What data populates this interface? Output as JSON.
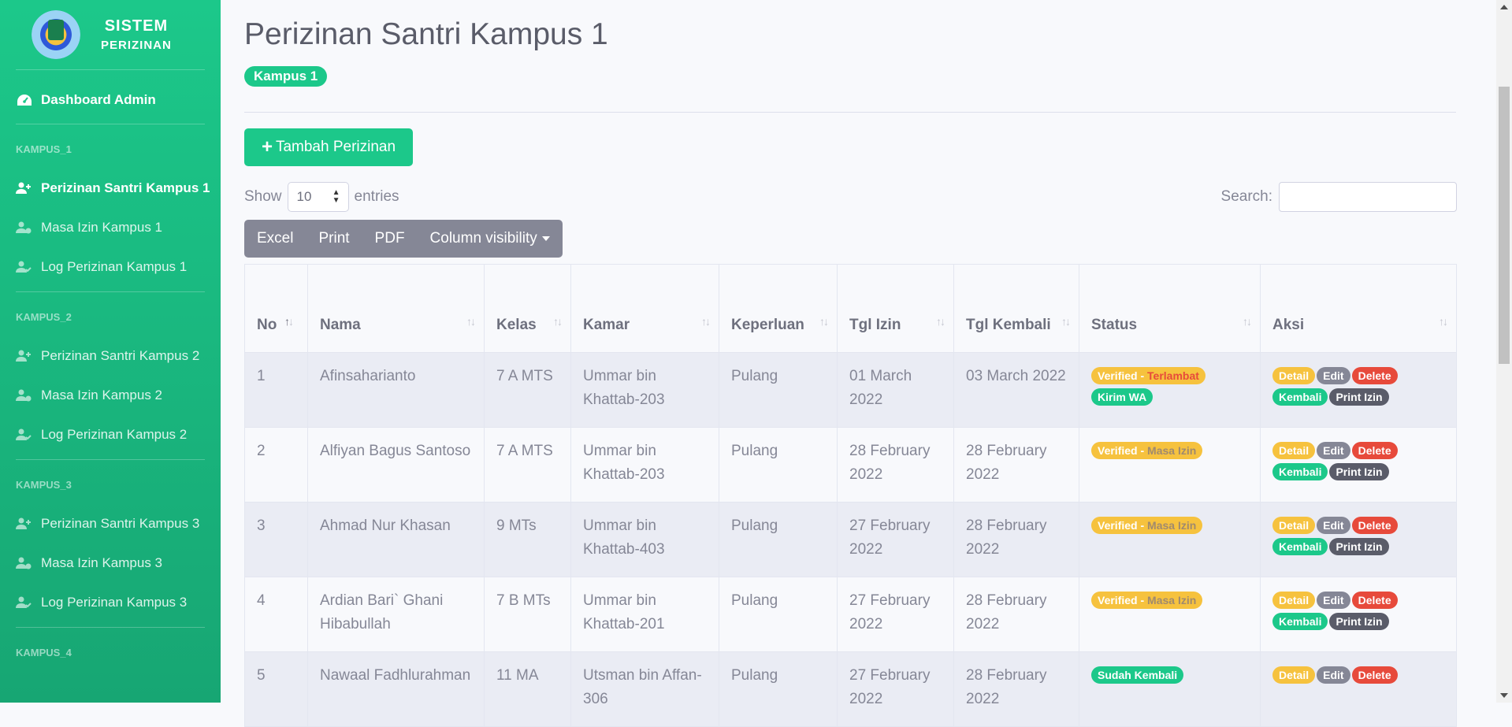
{
  "brand": {
    "line1": "SISTEM",
    "line2": "PERIZINAN"
  },
  "sidebar": {
    "dashboard": "Dashboard Admin",
    "sections": [
      {
        "heading": "KAMPUS_1",
        "items": [
          "Perizinan Santri Kampus 1",
          "Masa Izin Kampus 1",
          "Log Perizinan Kampus 1"
        ]
      },
      {
        "heading": "KAMPUS_2",
        "items": [
          "Perizinan Santri Kampus 2",
          "Masa Izin Kampus 2",
          "Log Perizinan Kampus 2"
        ]
      },
      {
        "heading": "KAMPUS_3",
        "items": [
          "Perizinan Santri Kampus 3",
          "Masa Izin Kampus 3",
          "Log Perizinan Kampus 3"
        ]
      },
      {
        "heading": "KAMPUS_4",
        "items": []
      }
    ]
  },
  "page": {
    "title": "Perizinan Santri Kampus 1",
    "badge": "Kampus 1",
    "add_button": "Tambah Perizinan"
  },
  "controls": {
    "show_label": "Show",
    "entries_value": "10",
    "entries_label": "entries",
    "search_label": "Search:",
    "search_value": "",
    "export_buttons": [
      "Excel",
      "Print",
      "PDF",
      "Column visibility"
    ]
  },
  "table": {
    "headers": [
      "No",
      "Nama",
      "Kelas",
      "Kamar",
      "Keperluan",
      "Tgl Izin",
      "Tgl Kembali",
      "Status",
      "Aksi"
    ],
    "rows": [
      {
        "no": "1",
        "nama": "Afinsaharianto",
        "kelas": "7 A MTS",
        "kamar": "Ummar bin Khattab-203",
        "keperluan": "Pulang",
        "tgl_izin": "01 March 2022",
        "tgl_kembali": "03 March 2022",
        "status": {
          "main": "Verified - ",
          "sub": "Terlambat",
          "extra": "Kirim WA"
        },
        "actions": [
          "Detail",
          "Edit",
          "Delete",
          "Kembali",
          "Print Izin"
        ]
      },
      {
        "no": "2",
        "nama": "Alfiyan Bagus Santoso",
        "kelas": "7 A MTS",
        "kamar": "Ummar bin Khattab-203",
        "keperluan": "Pulang",
        "tgl_izin": "28 February 2022",
        "tgl_kembali": "28 February 2022",
        "status": {
          "main": "Verified - ",
          "sub": "Masa Izin",
          "extra": ""
        },
        "actions": [
          "Detail",
          "Edit",
          "Delete",
          "Kembali",
          "Print Izin"
        ]
      },
      {
        "no": "3",
        "nama": "Ahmad Nur Khasan",
        "kelas": "9 MTs",
        "kamar": "Ummar bin Khattab-403",
        "keperluan": "Pulang",
        "tgl_izin": "27 February 2022",
        "tgl_kembali": "28 February 2022",
        "status": {
          "main": "Verified - ",
          "sub": "Masa Izin",
          "extra": ""
        },
        "actions": [
          "Detail",
          "Edit",
          "Delete",
          "Kembali",
          "Print Izin"
        ]
      },
      {
        "no": "4",
        "nama": "Ardian Bari` Ghani Hibabullah",
        "kelas": "7 B MTs",
        "kamar": "Ummar bin Khattab-201",
        "keperluan": "Pulang",
        "tgl_izin": "27 February 2022",
        "tgl_kembali": "28 February 2022",
        "status": {
          "main": "Verified - ",
          "sub": "Masa Izin",
          "extra": ""
        },
        "actions": [
          "Detail",
          "Edit",
          "Delete",
          "Kembali",
          "Print Izin"
        ]
      },
      {
        "no": "5",
        "nama": "Nawaal Fadhlurahman",
        "kelas": "11 MA",
        "kamar": "Utsman bin Affan-306",
        "keperluan": "Pulang",
        "tgl_izin": "27 February 2022",
        "tgl_kembali": "28 February 2022",
        "status": {
          "main": "Sudah Kembali",
          "sub": "",
          "extra": ""
        },
        "actions": [
          "Detail",
          "Edit",
          "Delete"
        ]
      }
    ]
  },
  "colors": {
    "primary_green": "#1cc88a",
    "warning": "#f6c23e",
    "danger": "#e74a3b",
    "secondary": "#858796",
    "dark": "#5a5c69"
  }
}
